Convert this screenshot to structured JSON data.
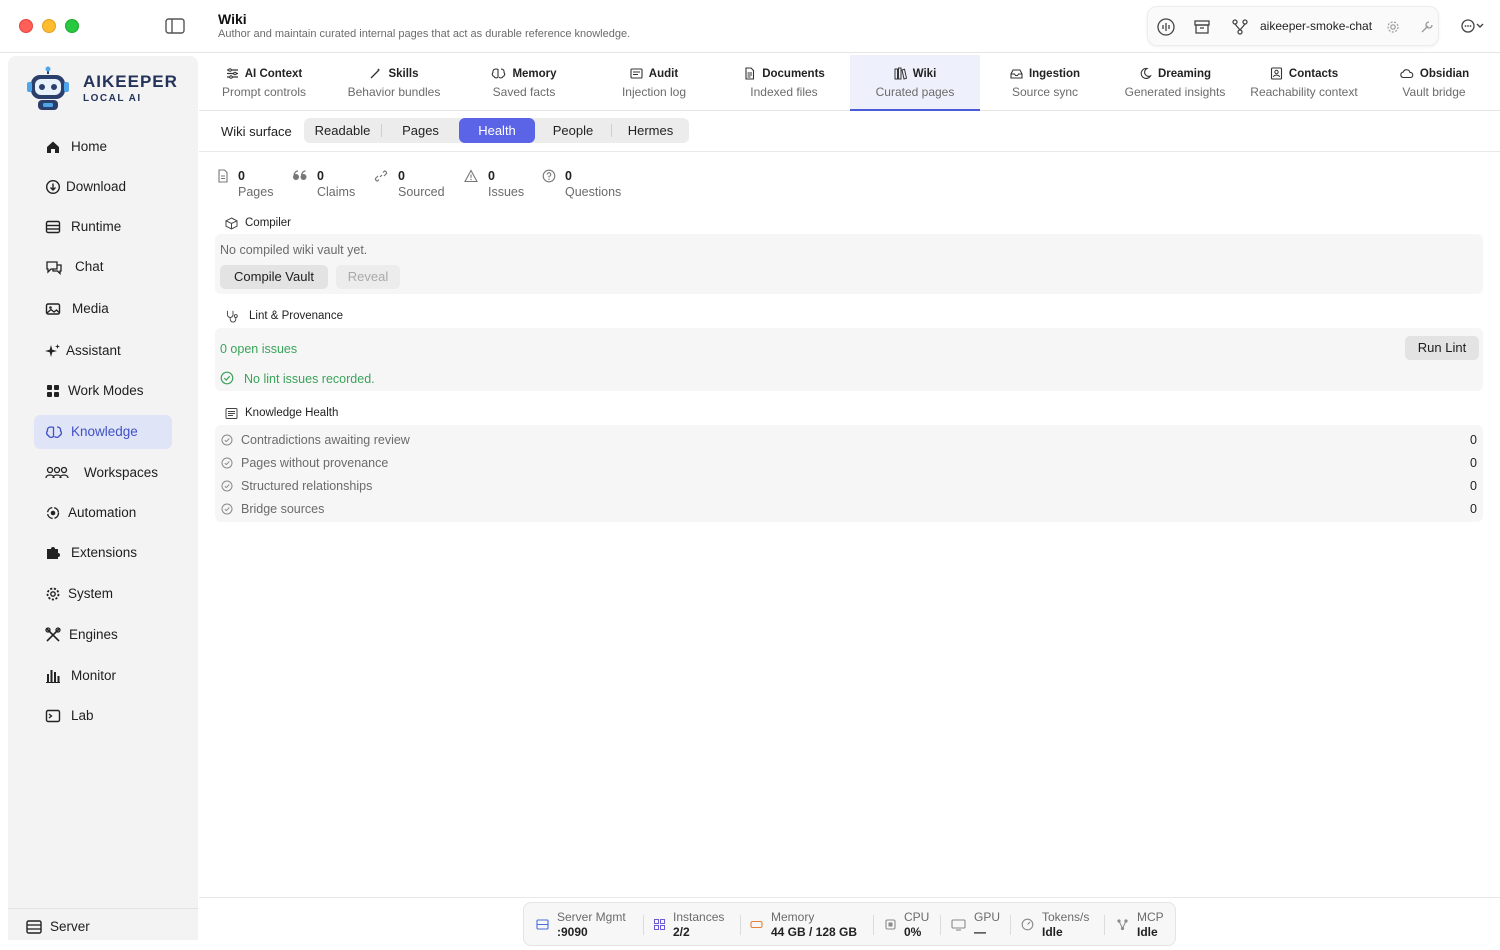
{
  "window": {
    "title": "Wiki",
    "subtitle": "Author and maintain curated internal pages that act as durable reference knowledge.",
    "session_name": "aikeeper-smoke-chat"
  },
  "brand": {
    "name": "AIKEEPER",
    "tagline": "LOCAL AI"
  },
  "sidebar": {
    "items": [
      {
        "label": "Home",
        "icon": "home-icon"
      },
      {
        "label": "Download",
        "icon": "download-icon"
      },
      {
        "label": "Runtime",
        "icon": "runtime-icon"
      },
      {
        "label": "Chat",
        "icon": "chat-icon"
      },
      {
        "label": "Media",
        "icon": "media-icon"
      },
      {
        "label": "Assistant",
        "icon": "sparkle-icon"
      },
      {
        "label": "Work Modes",
        "icon": "grid-icon"
      },
      {
        "label": "Knowledge",
        "icon": "brain-icon",
        "active": true
      },
      {
        "label": "Workspaces",
        "icon": "people-icon"
      },
      {
        "label": "Automation",
        "icon": "automation-icon"
      },
      {
        "label": "Extensions",
        "icon": "puzzle-icon"
      },
      {
        "label": "System",
        "icon": "gear-icon"
      },
      {
        "label": "Engines",
        "icon": "tools-icon"
      },
      {
        "label": "Monitor",
        "icon": "bar-chart-icon"
      },
      {
        "label": "Lab",
        "icon": "terminal-icon"
      }
    ],
    "footer": {
      "label": "Server",
      "icon": "server-icon"
    }
  },
  "tabs": [
    {
      "title": "AI Context",
      "sub": "Prompt controls",
      "icon": "sliders-icon"
    },
    {
      "title": "Skills",
      "sub": "Behavior bundles",
      "icon": "wand-icon"
    },
    {
      "title": "Memory",
      "sub": "Saved facts",
      "icon": "brain-icon"
    },
    {
      "title": "Audit",
      "sub": "Injection log",
      "icon": "log-icon"
    },
    {
      "title": "Documents",
      "sub": "Indexed files",
      "icon": "document-icon"
    },
    {
      "title": "Wiki",
      "sub": "Curated pages",
      "icon": "books-icon",
      "active": true
    },
    {
      "title": "Ingestion",
      "sub": "Source sync",
      "icon": "tray-icon"
    },
    {
      "title": "Dreaming",
      "sub": "Generated insights",
      "icon": "moon-icon"
    },
    {
      "title": "Contacts",
      "sub": "Reachability context",
      "icon": "contact-icon"
    },
    {
      "title": "Obsidian",
      "sub": "Vault bridge",
      "icon": "cloud-icon"
    }
  ],
  "surface": {
    "label": "Wiki surface",
    "options": [
      "Readable",
      "Pages",
      "Health",
      "People",
      "Hermes"
    ],
    "selected": "Health"
  },
  "stats": [
    {
      "value": "0",
      "label": "Pages",
      "icon": "page-icon"
    },
    {
      "value": "0",
      "label": "Claims",
      "icon": "quote-icon"
    },
    {
      "value": "0",
      "label": "Sourced",
      "icon": "link-icon"
    },
    {
      "value": "0",
      "label": "Issues",
      "icon": "warning-icon"
    },
    {
      "value": "0",
      "label": "Questions",
      "icon": "question-icon"
    }
  ],
  "compiler": {
    "title": "Compiler",
    "message": "No compiled wiki vault yet.",
    "compile_label": "Compile Vault",
    "reveal_label": "Reveal"
  },
  "lint": {
    "title": "Lint & Provenance",
    "open_issues": "0 open issues",
    "run_label": "Run Lint",
    "status": "No lint issues recorded."
  },
  "health": {
    "title": "Knowledge Health",
    "rows": [
      {
        "label": "Contradictions awaiting review",
        "value": "0"
      },
      {
        "label": "Pages without provenance",
        "value": "0"
      },
      {
        "label": "Structured relationships",
        "value": "0"
      },
      {
        "label": "Bridge sources",
        "value": "0"
      }
    ]
  },
  "statusbar": [
    {
      "label": "Server Mgmt",
      "value": ":9090",
      "icon": "server-icon",
      "color": "#4a6fd8"
    },
    {
      "label": "Instances",
      "value": "2/2",
      "icon": "instances-icon",
      "color": "#6a5ad8"
    },
    {
      "label": "Memory",
      "value": "44 GB / 128 GB",
      "icon": "memory-icon",
      "color": "#e8823a"
    },
    {
      "label": "CPU",
      "value": "0%",
      "icon": "cpu-icon",
      "color": "#8a8a8a"
    },
    {
      "label": "GPU",
      "value": "—",
      "icon": "gpu-icon",
      "color": "#8a8a8a"
    },
    {
      "label": "Tokens/s",
      "value": "Idle",
      "icon": "gauge-icon",
      "color": "#8a8a8a"
    },
    {
      "label": "MCP",
      "value": "Idle",
      "icon": "mcp-icon",
      "color": "#8a8a8a"
    }
  ],
  "colors": {
    "accent": "#5b63e6",
    "active_nav_bg": "#dfe4f7",
    "success": "#3aa35a"
  }
}
